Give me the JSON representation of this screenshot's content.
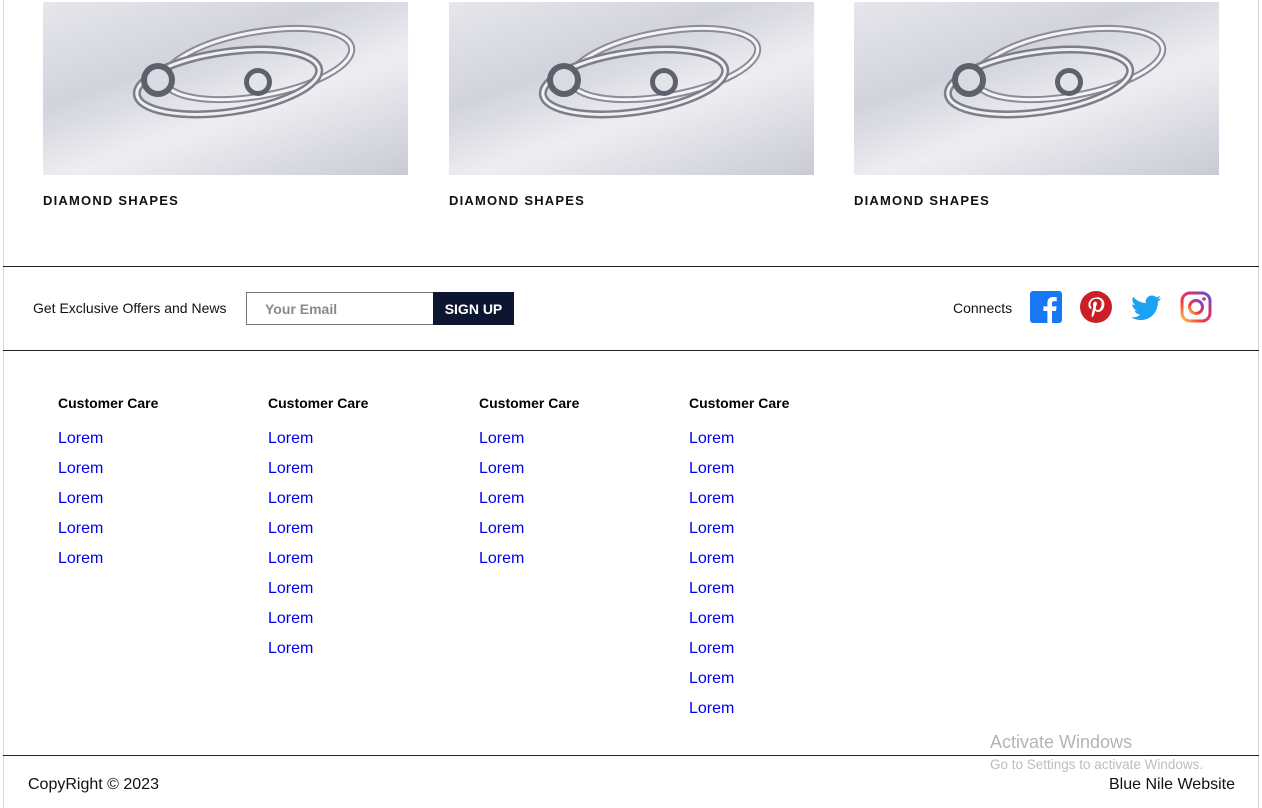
{
  "products": [
    {
      "title": "DIAMOND SHAPES"
    },
    {
      "title": "DIAMOND SHAPES"
    },
    {
      "title": "DIAMOND SHAPES"
    }
  ],
  "newsletter": {
    "label": "Get Exclusive Offers and News",
    "email_placeholder": "Your Email",
    "signup_label": "SIGN UP"
  },
  "social": {
    "label": "Connects",
    "icons": [
      "facebook-icon",
      "pinterest-icon",
      "twitter-icon",
      "instagram-icon"
    ],
    "colors": {
      "facebook": "#1877f2",
      "pinterest": "#cb1f27",
      "twitter": "#1da1f2",
      "instagram": "#c13584"
    }
  },
  "footer_columns": [
    {
      "title": "Customer Care",
      "links": [
        "Lorem",
        "Lorem",
        "Lorem",
        "Lorem",
        "Lorem"
      ]
    },
    {
      "title": "Customer Care",
      "links": [
        "Lorem",
        "Lorem",
        "Lorem",
        "Lorem",
        "Lorem",
        "Lorem",
        "Lorem",
        "Lorem"
      ]
    },
    {
      "title": "Customer Care",
      "links": [
        "Lorem",
        "Lorem",
        "Lorem",
        "Lorem",
        "Lorem"
      ]
    },
    {
      "title": "Customer Care",
      "links": [
        "Lorem",
        "Lorem",
        "Lorem",
        "Lorem",
        "Lorem",
        "Lorem",
        "Lorem",
        "Lorem",
        "Lorem",
        "Lorem"
      ]
    }
  ],
  "bottom": {
    "copyright": "CopyRight © 2023",
    "site_name": "Blue Nile Website"
  },
  "watermark": {
    "title": "Activate Windows",
    "subtitle": "Go to Settings to activate Windows."
  },
  "colors": {
    "signup_bg": "#0d1630",
    "link": "#0000ee",
    "divider": "#222222"
  }
}
